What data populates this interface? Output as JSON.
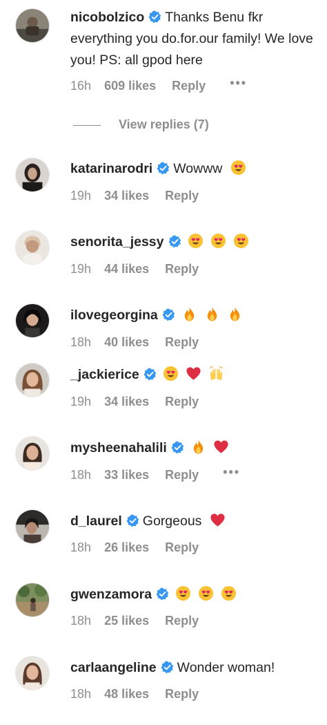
{
  "colors": {
    "verified": "#3897f0",
    "text": "#262626",
    "muted": "#8e8e8e"
  },
  "comments": [
    {
      "username": "nicobolzico",
      "verified": true,
      "text": "Thanks Benu fkr everything you do.for.our family! We love you! PS: all gpod here",
      "emojis": [],
      "time": "16h",
      "likes": "609 likes",
      "reply_label": "Reply",
      "more": "•••"
    },
    {
      "username": "katarinarodri",
      "verified": true,
      "text": "Wowww",
      "emojis": [
        "heart-eyes-emoji"
      ],
      "time": "19h",
      "likes": "34 likes",
      "reply_label": "Reply"
    },
    {
      "username": "senorita_jessy",
      "verified": true,
      "text": "",
      "emojis": [
        "heart-eyes-emoji",
        "heart-eyes-emoji",
        "heart-eyes-emoji"
      ],
      "time": "19h",
      "likes": "44 likes",
      "reply_label": "Reply"
    },
    {
      "username": "ilovegeorgina",
      "verified": true,
      "text": "",
      "emojis": [
        "fire-emoji",
        "fire-emoji",
        "fire-emoji"
      ],
      "time": "18h",
      "likes": "40 likes",
      "reply_label": "Reply"
    },
    {
      "username": "_jackierice",
      "verified": true,
      "text": "",
      "emojis": [
        "heart-eyes-emoji",
        "red-heart-emoji",
        "raised-hands-emoji"
      ],
      "time": "19h",
      "likes": "34 likes",
      "reply_label": "Reply"
    },
    {
      "username": "mysheenahalili",
      "verified": true,
      "text": "",
      "emojis": [
        "fire-emoji",
        "red-heart-emoji"
      ],
      "time": "18h",
      "likes": "33 likes",
      "reply_label": "Reply",
      "more": "•••"
    },
    {
      "username": "d_laurel",
      "verified": true,
      "text": "Gorgeous",
      "emojis": [
        "red-heart-emoji"
      ],
      "time": "18h",
      "likes": "26 likes",
      "reply_label": "Reply"
    },
    {
      "username": "gwenzamora",
      "verified": true,
      "text": "",
      "emojis": [
        "heart-eyes-emoji",
        "heart-eyes-emoji",
        "heart-eyes-emoji"
      ],
      "time": "18h",
      "likes": "25 likes",
      "reply_label": "Reply"
    },
    {
      "username": "carlaangeline",
      "verified": true,
      "text": "Wonder woman!",
      "emojis": [],
      "time": "18h",
      "likes": "48 likes",
      "reply_label": "Reply"
    }
  ],
  "view_replies": {
    "label": "View replies (7)"
  }
}
